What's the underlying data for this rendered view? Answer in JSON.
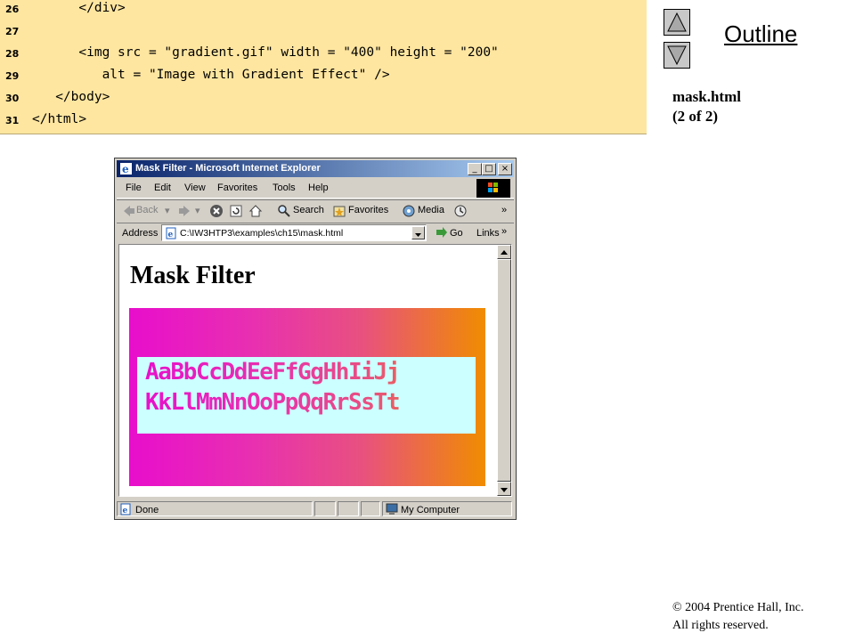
{
  "code": {
    "lines": [
      {
        "num": "26",
        "text": "      </div>"
      },
      {
        "num": "27",
        "text": ""
      },
      {
        "num": "28",
        "text": "      <img src = \"gradient.gif\" width = \"400\" height = \"200\""
      },
      {
        "num": "29",
        "text": "         alt = \"Image with Gradient Effect\" />"
      },
      {
        "num": "30",
        "text": "   </body>"
      },
      {
        "num": "31",
        "text": "</html>"
      }
    ]
  },
  "slide": {
    "outline_label": "Outline",
    "title_line1": "mask.html",
    "title_line2": "(2 of 2)",
    "copyright_line1": "© 2004 Prentice Hall, Inc.",
    "copyright_line2": "All rights reserved."
  },
  "browser": {
    "window_title": "Mask Filter - Microsoft Internet Explorer",
    "menu": [
      "File",
      "Edit",
      "View",
      "Favorites",
      "Tools",
      "Help"
    ],
    "toolbar": {
      "back": "Back",
      "search": "Search",
      "favorites": "Favorites",
      "media": "Media",
      "more": "»"
    },
    "address": {
      "label": "Address",
      "value": "C:\\IW3HTP3\\examples\\ch15\\mask.html",
      "go": "Go",
      "links": "Links",
      "more": "»"
    },
    "page": {
      "heading": "Mask Filter",
      "mask_line1": "AaBbCcDdEeFfGgHhIiJj",
      "mask_line2": "KkLlMmNnOoPpQqRrSsTt"
    },
    "status": {
      "left": "Done",
      "zone": "My Computer"
    }
  },
  "colors": {
    "code_background": "#ffe6a0",
    "gradient_start": "#e80ecc",
    "gradient_end": "#f08c00",
    "mask_background": "#ccffff",
    "titlebar": "#0a246a"
  }
}
